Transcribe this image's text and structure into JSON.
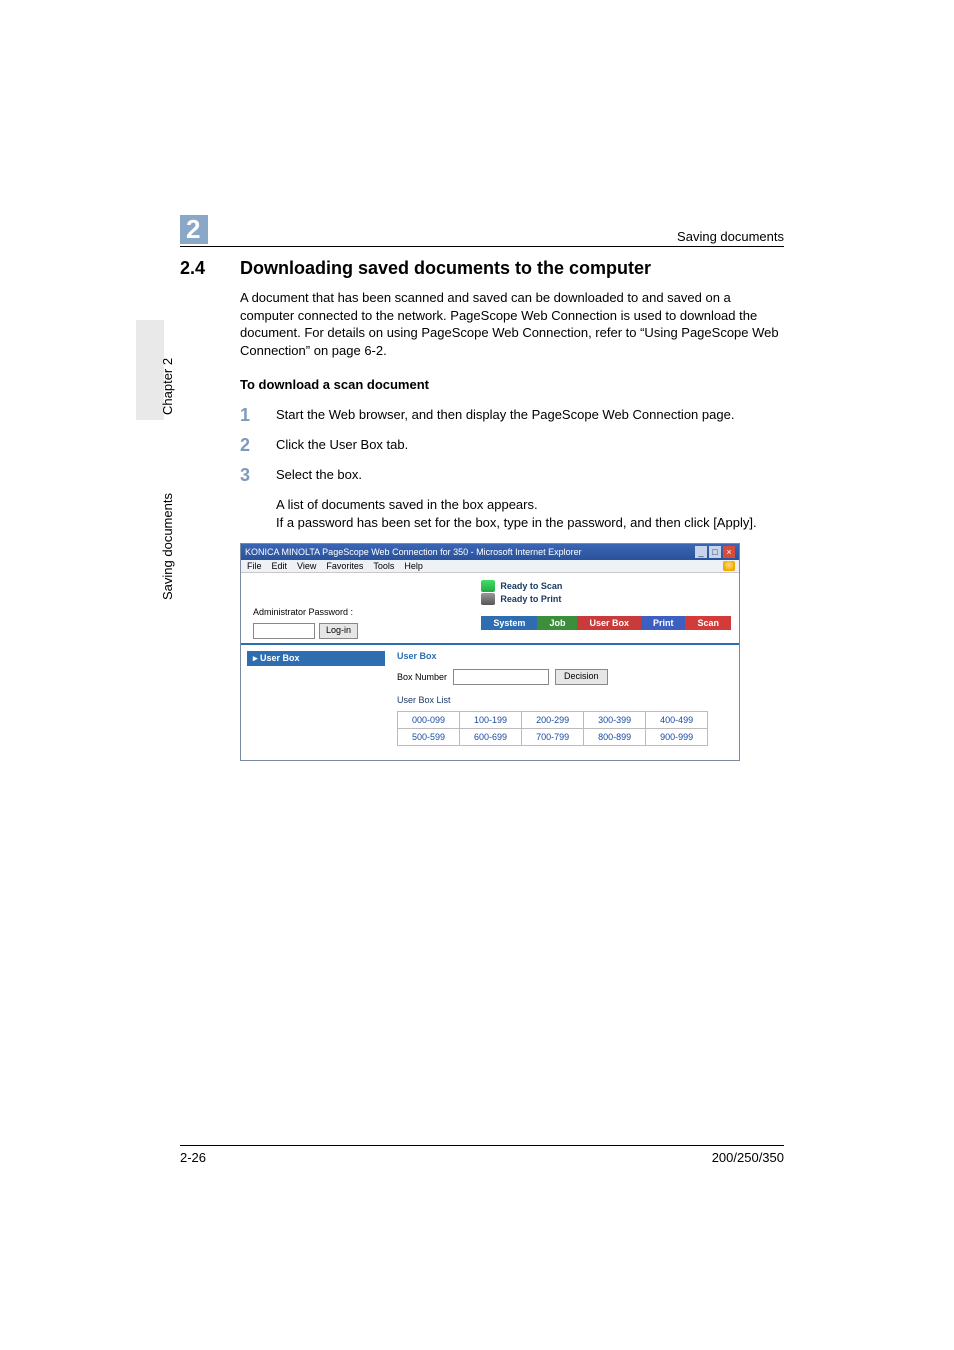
{
  "header": {
    "chapter_number": "2",
    "running_title": "Saving documents"
  },
  "sidebar": {
    "chapter_label": "Chapter 2",
    "section_label": "Saving documents"
  },
  "content": {
    "section_number": "2.4",
    "section_title": "Downloading saved documents to the computer",
    "intro": "A document that has been scanned and saved can be downloaded to and saved on a computer connected to the network. PageScope Web Connection is used to download the document. For details on using PageScope Web Connection, refer to “Using PageScope Web Connection” on page 6-2.",
    "subheading": "To download a scan document",
    "steps": [
      {
        "num": "1",
        "text": "Start the Web browser, and then display the PageScope Web Connection page."
      },
      {
        "num": "2",
        "text": "Click the User Box tab."
      },
      {
        "num": "3",
        "text": "Select the box."
      }
    ],
    "substep": "A list of documents saved in the box appears.\nIf a password has been set for the box, type in the password, and then click [Apply]."
  },
  "screenshot": {
    "window_title": "KONICA MINOLTA PageScope Web Connection for 350 - Microsoft Internet Explorer",
    "menubar": [
      "File",
      "Edit",
      "View",
      "Favorites",
      "Tools",
      "Help"
    ],
    "status_scan": "Ready to Scan",
    "status_print": "Ready to Print",
    "admin_label": "Administrator Password :",
    "login_button": "Log-in",
    "tabs": {
      "system": "System",
      "job": "Job",
      "userbox": "User Box",
      "print": "Print",
      "scan": "Scan"
    },
    "side_item": "▸ User Box",
    "panel_heading": "User Box",
    "box_number_label": "Box Number",
    "decision_button": "Decision",
    "list_label": "User Box List",
    "ranges": [
      [
        "000-099",
        "100-199",
        "200-299",
        "300-399",
        "400-499"
      ],
      [
        "500-599",
        "600-699",
        "700-799",
        "800-899",
        "900-999"
      ]
    ]
  },
  "footer": {
    "page_number": "2-26",
    "model": "200/250/350"
  }
}
